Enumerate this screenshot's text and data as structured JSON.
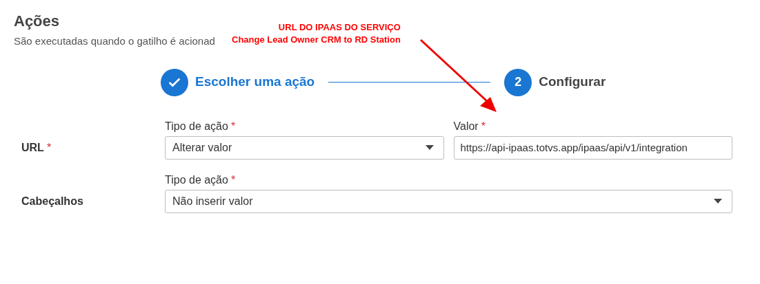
{
  "header": {
    "title": "Ações",
    "subtitle": "São executadas quando o gatilho é acionad"
  },
  "annotation": {
    "lines": [
      "URL DO IPAAS DO SERVIÇO",
      "Change Lead Owner CRM to RD Station"
    ]
  },
  "stepper": [
    {
      "label": "Escolher uma ação",
      "done": true
    },
    {
      "number": "2",
      "label": "Configurar",
      "done": false
    }
  ],
  "rows": [
    {
      "label": "URL",
      "required": true,
      "fields": [
        {
          "kind": "select",
          "label": "Tipo de ação",
          "required": true,
          "value": "Alterar valor"
        },
        {
          "kind": "input",
          "label": "Valor",
          "required": true,
          "value": "https://api-ipaas.totvs.app/ipaas/api/v1/integration"
        }
      ]
    },
    {
      "label": "Cabeçalhos",
      "required": false,
      "fields": [
        {
          "kind": "select",
          "label": "Tipo de ação",
          "required": true,
          "value": "Não inserir valor"
        }
      ]
    }
  ],
  "required_mark": "*"
}
